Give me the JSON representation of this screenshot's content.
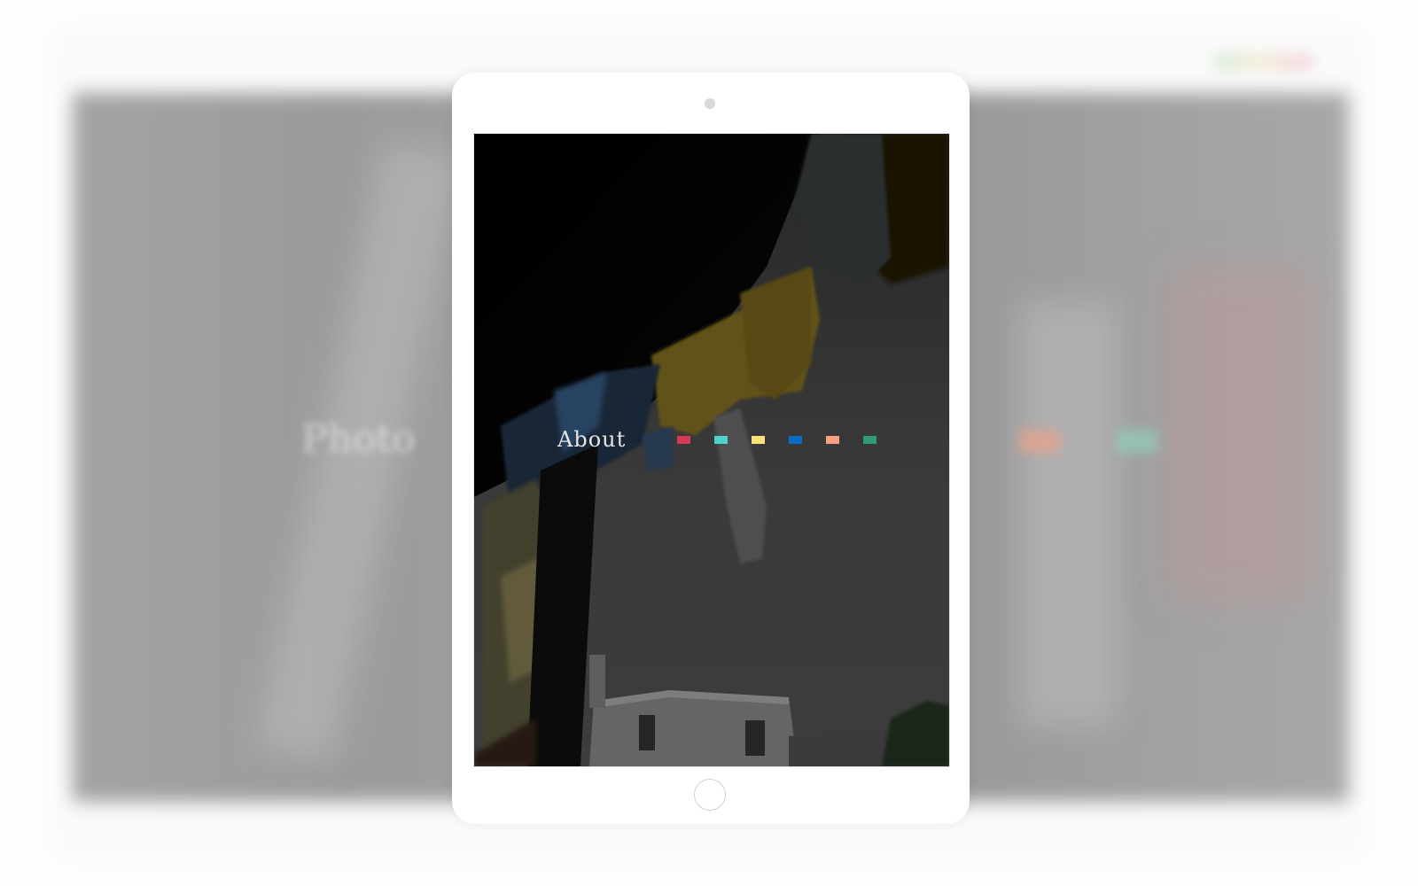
{
  "page": {
    "background_color": "#fdfdfd",
    "background_title": "Photo"
  },
  "tablet": {
    "frame_color": "#ffffff",
    "screen": {
      "nav_label": "About",
      "swatches": [
        {
          "name": "red",
          "color": "#d23a55"
        },
        {
          "name": "teal",
          "color": "#4fd1cc"
        },
        {
          "name": "yellow",
          "color": "#f7e27a"
        },
        {
          "name": "blue",
          "color": "#0a6bc4"
        },
        {
          "name": "salmon",
          "color": "#f5a083"
        },
        {
          "name": "green",
          "color": "#2f9a73"
        }
      ]
    }
  },
  "icons": {
    "camera": "camera-icon",
    "home_button": "home-button-icon"
  }
}
